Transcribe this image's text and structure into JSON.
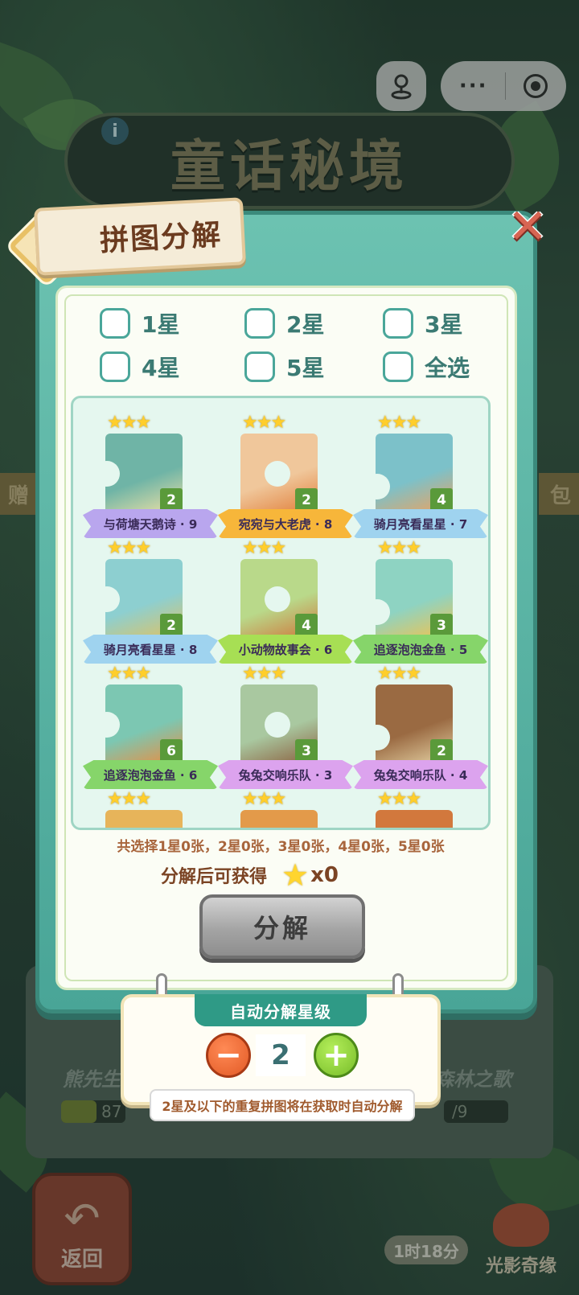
{
  "capsule": {
    "more_icon": "ellipsis-icon",
    "close_icon": "target-icon",
    "left_icon": "joystick-icon"
  },
  "background": {
    "game_title": "童话秘境",
    "side_left": "赠",
    "side_right": "包",
    "under_left_label": "熊先生",
    "under_right_label": "森林之歌",
    "under_left_progress": "87",
    "under_right_progress": "/9",
    "back_label": "返回",
    "timer": "1时18分",
    "light_label": "光影奇缘"
  },
  "dialog": {
    "title": "拼图分解",
    "close_icon": "close-x-icon",
    "filters": [
      {
        "label": "1星",
        "checked": false
      },
      {
        "label": "2星",
        "checked": false
      },
      {
        "label": "3星",
        "checked": false
      },
      {
        "label": "4星",
        "checked": false
      },
      {
        "label": "5星",
        "checked": false
      },
      {
        "label": "全选",
        "checked": false
      }
    ],
    "puzzles": [
      {
        "name": "与荷塘天鹅诗 · 9",
        "stars": "★★★",
        "count": "2",
        "ribbon": "#b9a6ee",
        "art": [
          "#6fb4a6",
          "#f3e3a5"
        ]
      },
      {
        "name": "宛宛与大老虎 · 8",
        "stars": "★★★",
        "count": "2",
        "ribbon": "#f7b63a",
        "art": [
          "#f0c79b",
          "#e07b35"
        ]
      },
      {
        "name": "骑月亮看星星 · 7",
        "stars": "★★★",
        "count": "4",
        "ribbon": "#9fd3ef",
        "art": [
          "#7cc1c9",
          "#f2a15a"
        ]
      },
      {
        "name": "骑月亮看星星 · 8",
        "stars": "★★★",
        "count": "2",
        "ribbon": "#9fd3ef",
        "art": [
          "#8dcfd0",
          "#e2c25f"
        ]
      },
      {
        "name": "小动物故事会 · 6",
        "stars": "★★★",
        "count": "4",
        "ribbon": "#a7df54",
        "art": [
          "#b9d98a",
          "#d07238"
        ]
      },
      {
        "name": "追逐泡泡金鱼 · 5",
        "stars": "★★★",
        "count": "3",
        "ribbon": "#86d56a",
        "art": [
          "#8ed3c2",
          "#f6c248"
        ]
      },
      {
        "name": "追逐泡泡金鱼 · 6",
        "stars": "★★★",
        "count": "6",
        "ribbon": "#86d56a",
        "art": [
          "#7cc7b2",
          "#f08a3a"
        ]
      },
      {
        "name": "兔兔交响乐队 · 3",
        "stars": "★★★",
        "count": "3",
        "ribbon": "#dca3ee",
        "art": [
          "#a9c8a0",
          "#8a5a3a"
        ]
      },
      {
        "name": "兔兔交响乐队 · 4",
        "stars": "★★★",
        "count": "2",
        "ribbon": "#dca3ee",
        "art": [
          "#9a6a42",
          "#e8d6a8"
        ]
      },
      {
        "name": "",
        "stars": "★★★",
        "count": "",
        "ribbon": "",
        "art": [
          "#e7b45a",
          "#f3d9a0"
        ]
      },
      {
        "name": "",
        "stars": "★★★",
        "count": "",
        "ribbon": "",
        "art": [
          "#e39a4a",
          "#f4e1b0"
        ]
      },
      {
        "name": "",
        "stars": "★★★",
        "count": "",
        "ribbon": "",
        "art": [
          "#d2783d",
          "#f0c27a"
        ]
      }
    ],
    "summary": "共选择1星0张，2星0张，3星0张，4星0张，5星0张",
    "gain_label": "分解后可获得",
    "gain_icon": "star-icon",
    "gain_value": "x0",
    "decompose_button": "分解"
  },
  "auto": {
    "title": "自动分解星级",
    "minus": "−",
    "plus": "+",
    "level": "2",
    "hint": "2星及以下的重复拼图将在获取时自动分解"
  }
}
